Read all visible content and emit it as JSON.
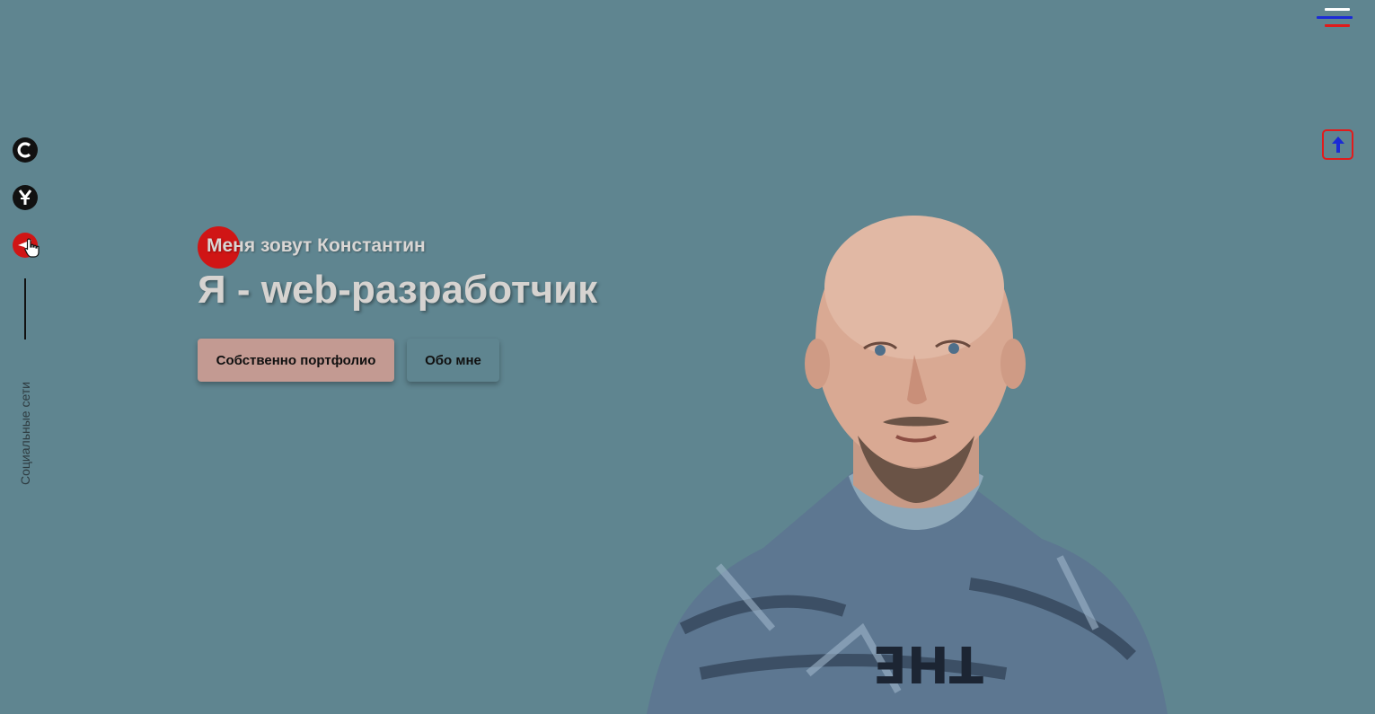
{
  "social": {
    "items": [
      {
        "name": "circle-c-icon",
        "color": "#111111"
      },
      {
        "name": "yen-coin-icon",
        "color": "#111111"
      },
      {
        "name": "telegram-icon",
        "color": "#d01515"
      }
    ],
    "label": "Социальные сети"
  },
  "hero": {
    "intro": "Меня зовут Константин",
    "headline": "Я - web-разработчик",
    "buttons": {
      "portfolio": "Собственно портфолио",
      "about": "Обо мне"
    }
  },
  "colors": {
    "background": "#5f8590",
    "accent_red": "#d01515",
    "burger_blue": "#1b2bd6",
    "portfolio_button": "#c39a92"
  },
  "icons": {
    "menu": "hamburger-icon",
    "scroll_up": "arrow-up-icon",
    "cursor": "hand-pointer-icon"
  }
}
